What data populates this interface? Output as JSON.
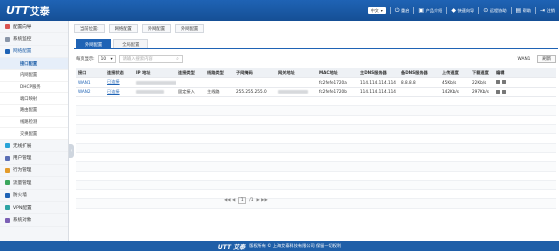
{
  "brand": {
    "logo_latin": "UTT",
    "logo_cjk": "艾泰"
  },
  "topbar": {
    "language": "中文",
    "items": [
      {
        "icon": "power-icon",
        "glyph": "⏻",
        "label": "重启"
      },
      {
        "icon": "save-icon",
        "glyph": "▣",
        "label": "产品介绍"
      },
      {
        "icon": "wizard-icon",
        "glyph": "◆",
        "label": "快速向导"
      },
      {
        "icon": "diagnose-icon",
        "glyph": "⊙",
        "label": "远程协助"
      },
      {
        "icon": "help-icon",
        "glyph": "▤",
        "label": "帮助"
      },
      {
        "icon": "logout-icon",
        "glyph": "⇥",
        "label": "注销"
      }
    ]
  },
  "sidebar": {
    "items": [
      {
        "label": "配置向导",
        "color": "#d9534f",
        "level": 1
      },
      {
        "label": "系统监控",
        "color": "#8a96a8",
        "level": 1
      },
      {
        "label": "网络配置",
        "color": "#1f63b5",
        "level": 1,
        "open": true
      },
      {
        "label": "接口配置",
        "level": 2,
        "active": true
      },
      {
        "label": "内网配置",
        "level": 2
      },
      {
        "label": "DHCP服务",
        "level": 2
      },
      {
        "label": "端口映射",
        "level": 2
      },
      {
        "label": "路由配置",
        "level": 2
      },
      {
        "label": "线路检测",
        "level": 2
      },
      {
        "label": "交换配置",
        "level": 2
      },
      {
        "label": "无线扩展",
        "color": "#29a4d8",
        "level": 1
      },
      {
        "label": "用户管理",
        "color": "#5b6fb5",
        "level": 1
      },
      {
        "label": "行为管理",
        "color": "#e39b2b",
        "level": 1
      },
      {
        "label": "流量管理",
        "color": "#3aa65c",
        "level": 1
      },
      {
        "label": "防火墙",
        "color": "#1f63b5",
        "level": 1
      },
      {
        "label": "VPN配置",
        "color": "#2fa4a4",
        "level": 1
      },
      {
        "label": "系统对象",
        "color": "#7b5fb5",
        "level": 1
      }
    ]
  },
  "breadcrumbs": [
    "当前位置:",
    "网络配置",
    "外网配置",
    "外网配置"
  ],
  "tabs": [
    {
      "label": "外网配置",
      "active": true
    },
    {
      "label": "全局配置",
      "active": false
    }
  ],
  "controls": {
    "per_page_label": "每页显示:",
    "per_page_value": "10",
    "search_placeholder": "请输入搜索内容",
    "wan_label": "WAN1",
    "refresh_label": "刷新"
  },
  "table": {
    "headers": [
      "接口",
      "连接状态",
      "IP 地址",
      "连接类型",
      "线路类型",
      "子网掩码",
      "网关地址",
      "MAC地址",
      "主DNS服务器",
      "备DNS服务器",
      "上传速度",
      "下载速度",
      "编辑"
    ],
    "rows": [
      {
        "iface": "WAN1",
        "status": "已连接",
        "conn_type": "",
        "line_type": "",
        "mask": "",
        "mac": "fc2fefe1720a",
        "dns1": "114.114.114.114",
        "dns2": "8.8.8.8",
        "up": "45Kb/s",
        "down": "22Kb/s"
      },
      {
        "iface": "WAN2",
        "status": "已连接",
        "conn_type": "固定接入",
        "line_type": "主线路",
        "mask": "255.255.255.0",
        "mac": "fc2fefe1720b",
        "dns1": "114.114.114.114",
        "dns2": "",
        "up": "142Kb/s",
        "down": "297Kb/s"
      }
    ]
  },
  "pager": {
    "prev": "◀◀ ◀",
    "current": "1",
    "total": "/1",
    "next": "▶ ▶▶"
  },
  "footer": {
    "logo": "UTT 艾泰",
    "text": "版权所有 © 上海艾泰科技有限公司 保留一切权利"
  }
}
